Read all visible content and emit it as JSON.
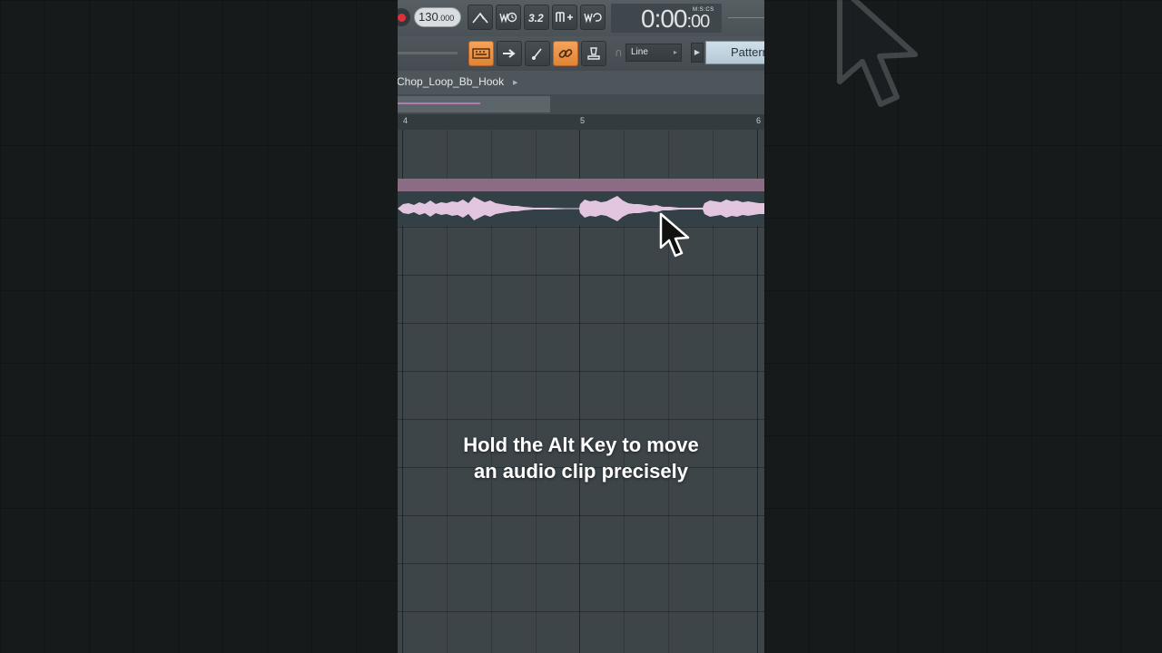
{
  "toolbar": {
    "tempo_main": "130",
    "tempo_decimals": ".000",
    "time_main": "0:00",
    "time_sub": ":00",
    "time_label": "M:S:CS",
    "snap_value": "Line",
    "pattern_label": "Pattern"
  },
  "playlist": {
    "window_title": "Chop_Loop_Bb_Hook",
    "ruler_marks": [
      "4",
      "5",
      "6"
    ]
  },
  "caption": {
    "line1": "Hold the Alt Key to move",
    "line2": "an audio clip precisely"
  },
  "colors": {
    "clip_header": "#8c6b84",
    "waveform": "#e2c6e0",
    "accent_orange": "#f39b4f"
  }
}
